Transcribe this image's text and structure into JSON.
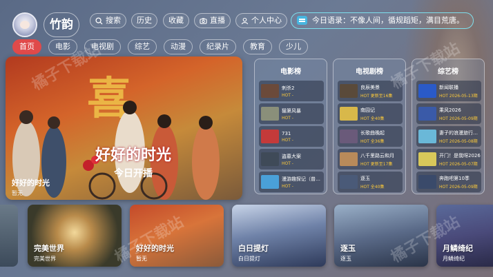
{
  "user": {
    "name": "竹韵"
  },
  "nav": [
    {
      "label": "搜索",
      "icon": "search-icon"
    },
    {
      "label": "历史",
      "icon": ""
    },
    {
      "label": "收藏",
      "icon": ""
    },
    {
      "label": "直播",
      "icon": "camera-icon"
    },
    {
      "label": "个人中心",
      "icon": "user-icon"
    }
  ],
  "quote": "今日语录：不像人间，循规蹈矩，满目荒唐。",
  "tabs": [
    "首页",
    "电影",
    "电视剧",
    "综艺",
    "动漫",
    "纪录片",
    "教育",
    "少儿"
  ],
  "active_tab": "首页",
  "hero": {
    "poster_char": "喜",
    "poster_title": "好好的时光",
    "poster_subtitle": "今日开播",
    "name": "好好的时光",
    "sub": "暂无"
  },
  "rankings": [
    {
      "title": "电影榜",
      "items": [
        {
          "name": "刺杀2",
          "hot": "HOT -",
          "color": "#6b4a3a"
        },
        {
          "name": "猫第风暴",
          "hot": "HOT -",
          "color": "#8a8f7a"
        },
        {
          "name": "731",
          "hot": "HOT -",
          "color": "#c43a3a"
        },
        {
          "name": "盗墓大案",
          "hot": "HOT -",
          "color": "#3f4a58"
        },
        {
          "name": "漫游趣探记（普通话）",
          "hot": "HOT -",
          "color": "#4aa0d8"
        }
      ]
    },
    {
      "title": "电视剧榜",
      "items": [
        {
          "name": "良辰美景",
          "hot": "HOT 更新至16集",
          "color": "#5a4a3a"
        },
        {
          "name": "南园记",
          "hot": "HOT 全40集",
          "color": "#d8b84a"
        },
        {
          "name": "长歌曲晚起",
          "hot": "HOT 全36集",
          "color": "#6a5a7a"
        },
        {
          "name": "八千里路云和月",
          "hot": "HOT 更新至17集",
          "color": "#b88a5a"
        },
        {
          "name": "逐玉",
          "hot": "HOT 全40集",
          "color": "#4a5a78"
        }
      ]
    },
    {
      "title": "综艺榜",
      "items": [
        {
          "name": "新闻联播",
          "hot": "HOT 2026-05-13期",
          "color": "#2a5ac8"
        },
        {
          "name": "乘风2026",
          "hot": "HOT 2026-05-09期",
          "color": "#3a5aa8"
        },
        {
          "name": "妻子的浪漫旅行2026",
          "hot": "HOT 2026-05-08期",
          "color": "#6ab8d8"
        },
        {
          "name": "开门！是我呀2026",
          "hot": "HOT 2026-05-07期",
          "color": "#d8c85a"
        },
        {
          "name": "奔跑吧第10季",
          "hot": "HOT 2026-05-09期",
          "color": "#3a4a6a"
        }
      ]
    }
  ],
  "bottom_cards": [
    {
      "name": "完美世界",
      "sub": "完美世界"
    },
    {
      "name": "好好的时光",
      "sub": "暂无"
    },
    {
      "name": "白日提灯",
      "sub": "白日提灯"
    },
    {
      "name": "逐玉",
      "sub": "逐玉"
    },
    {
      "name": "月鳞绮纪",
      "sub": "月鳞绮纪"
    }
  ],
  "watermark": "橘子下载站"
}
